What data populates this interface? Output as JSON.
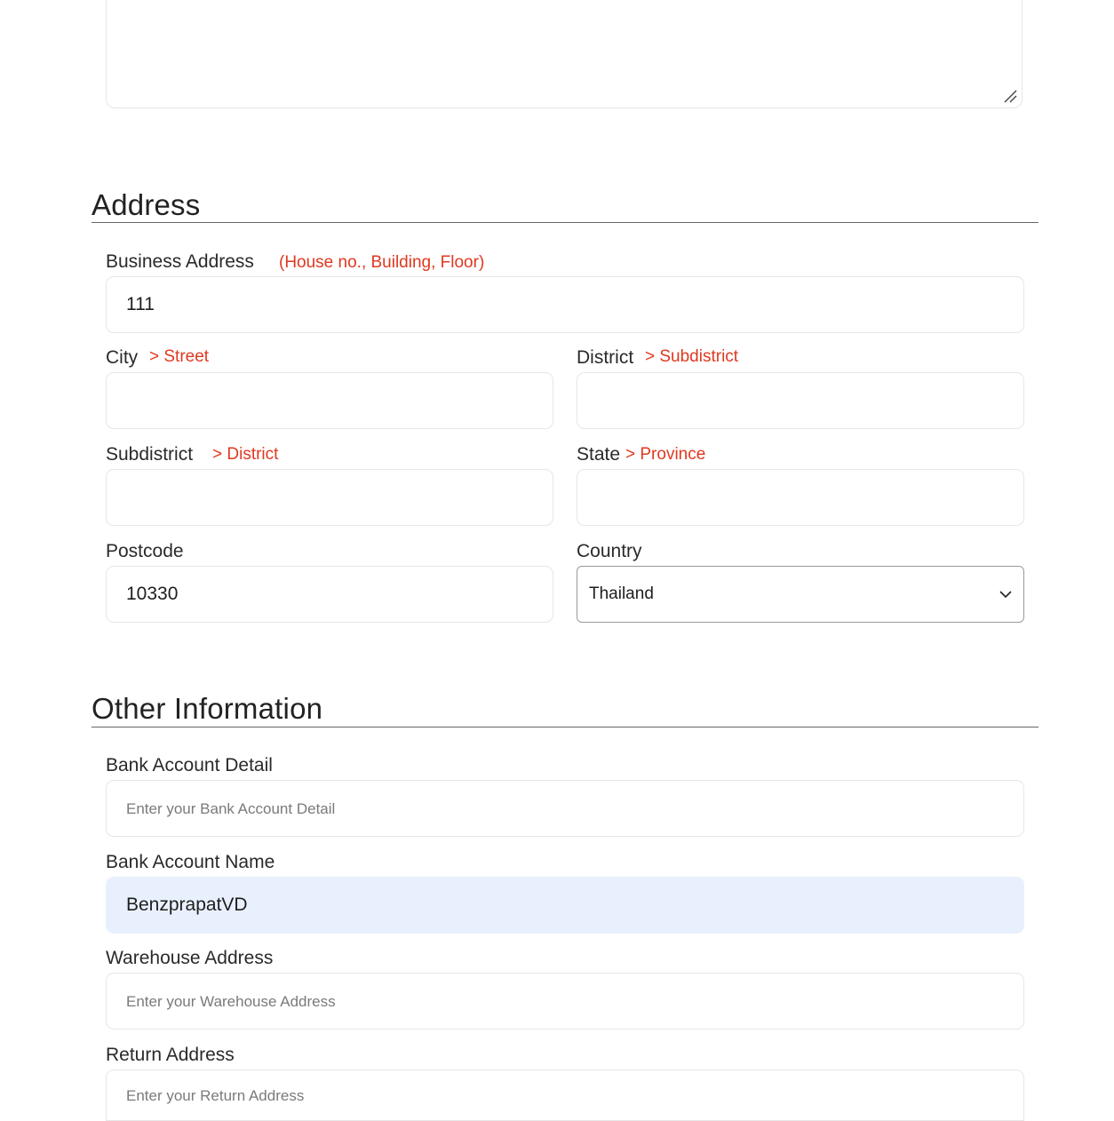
{
  "address_section": {
    "title": "Address",
    "business_address": {
      "label": "Business Address",
      "hint": "(House no., Building, Floor)",
      "value": "111"
    },
    "city": {
      "label": "City",
      "hint": "> Street",
      "value": ""
    },
    "district": {
      "label": "District",
      "hint": "> Subdistrict",
      "value": ""
    },
    "subdistrict": {
      "label": "Subdistrict",
      "hint": "> District",
      "value": ""
    },
    "state": {
      "label": "State",
      "hint": "> Province",
      "value": ""
    },
    "postcode": {
      "label": "Postcode",
      "value": "10330"
    },
    "country": {
      "label": "Country",
      "value": "Thailand"
    }
  },
  "other_section": {
    "title": "Other Information",
    "bank_account_detail": {
      "label": "Bank Account Detail",
      "placeholder": "Enter your Bank Account Detail",
      "value": ""
    },
    "bank_account_name": {
      "label": "Bank Account Name",
      "value": "BenzprapatVD"
    },
    "warehouse_address": {
      "label": "Warehouse Address",
      "placeholder": "Enter your Warehouse Address",
      "value": ""
    },
    "return_address": {
      "label": "Return Address",
      "placeholder": "Enter your Return Address",
      "value": ""
    }
  },
  "icons": {
    "resize": "resize-handle-icon",
    "dropdown": "chevron-down-icon"
  },
  "colors": {
    "hint": "#e0381f",
    "autofill_bg": "#e8f0fe",
    "border": "#e6e6e6"
  }
}
